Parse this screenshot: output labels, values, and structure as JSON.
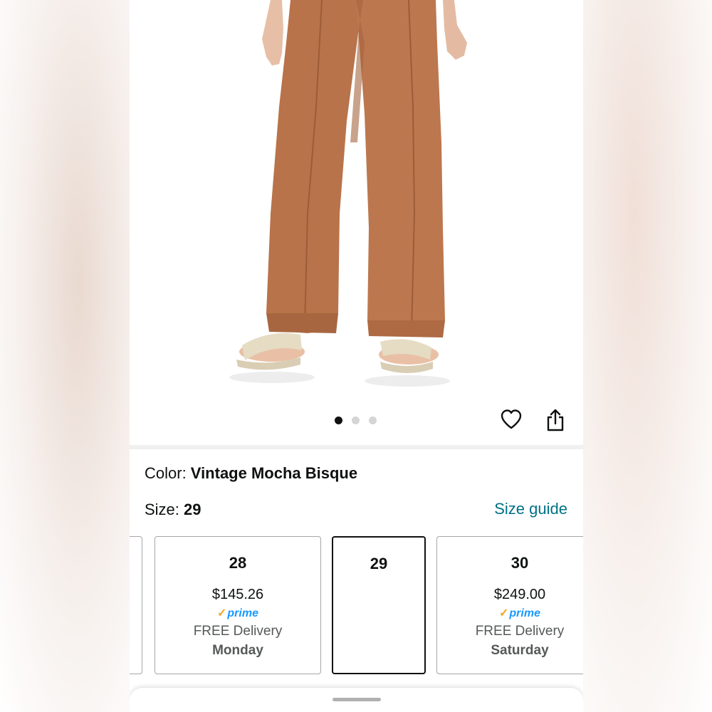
{
  "gallery": {
    "dots": [
      true,
      false,
      false
    ],
    "actions": {
      "wishlist_icon": "heart-icon",
      "share_icon": "share-icon"
    }
  },
  "product": {
    "color_label": "Color: ",
    "color_value": "Vintage Mocha Bisque",
    "size_label": "Size: ",
    "size_value": "29",
    "size_guide_link": "Size guide",
    "pants_color": "#b8734a"
  },
  "sizes": [
    {
      "size": "28",
      "price": "$145.26",
      "prime": "prime",
      "delivery": "FREE Delivery",
      "day": "Monday"
    },
    {
      "size": "29",
      "price": "",
      "prime": "",
      "delivery": "",
      "day": ""
    },
    {
      "size": "30",
      "price": "$249.00",
      "prime": "prime",
      "delivery": "FREE Delivery",
      "day": "Saturday"
    }
  ],
  "colors": {
    "link": "#007185",
    "prime_blue": "#1a98ff",
    "prime_check": "#f5a623"
  }
}
